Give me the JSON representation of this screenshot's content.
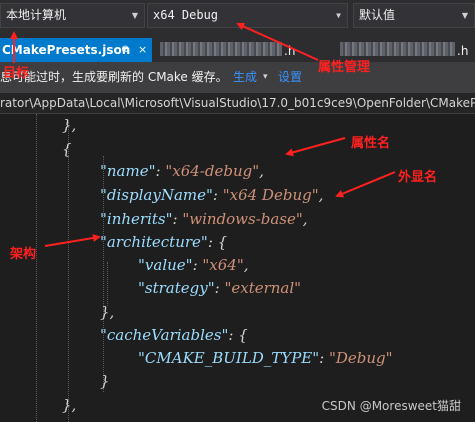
{
  "toolbar": {
    "target": "本地计算机",
    "configuration": "x64 Debug",
    "preset": "默认值"
  },
  "tabs": {
    "active_label": "CMakePresets.json",
    "pin_glyph": "⊕",
    "close_glyph": "×",
    "other_ext_1": ".h",
    "other_ext_2": ".h"
  },
  "infobar": {
    "message": "息可能过时，生成要刷新的 CMake 缓存。",
    "action_generate": "生成",
    "action_settings": "设置"
  },
  "path": "rator\\AppData\\Local\\Microsoft\\VisualStudio\\17.0_b01c9ce9\\OpenFolder\\CMakePre",
  "code": {
    "close_obj": "},",
    "open_obj": "{",
    "name_key": "\"name\"",
    "name_val": "\"x64-debug\"",
    "display_key": "\"displayName\"",
    "display_val": "\"x64 Debug\"",
    "inherits_key": "\"inherits\"",
    "inherits_val": "\"windows-base\"",
    "arch_key": "\"architecture\"",
    "value_key": "\"value\"",
    "value_val": "\"x64\"",
    "strategy_key": "\"strategy\"",
    "strategy_val": "\"external\"",
    "cache_key": "\"cacheVariables\"",
    "build_type_key": "\"CMAKE_BUILD_TYPE\"",
    "build_type_val": "\"Debug\"",
    "colon": ": ",
    "comma": ",",
    "brace_open": " {",
    "brace_close": "}",
    "brace_close_comma": "},"
  },
  "annotations": {
    "target": "目标",
    "property_manager": "属性管理",
    "property_name": "属性名",
    "display_name": "外显名",
    "architecture": "架构"
  },
  "watermark": "CSDN @Moresweet猫甜",
  "colors": {
    "accent": "#007acc",
    "annotation": "#ff2020",
    "string": "#ce9178",
    "key": "#9cdcfe",
    "link": "#3794ff"
  }
}
